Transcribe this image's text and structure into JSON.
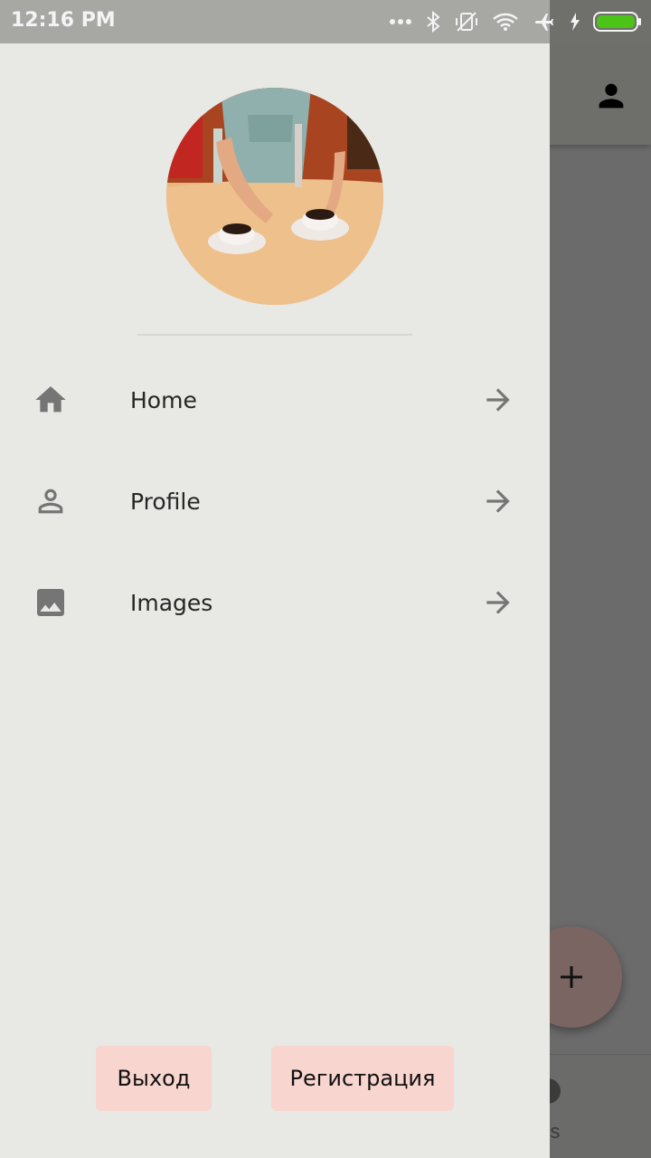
{
  "status_bar": {
    "time": "12:16 PM"
  },
  "drawer": {
    "menu": [
      {
        "label": "Home",
        "icon": "home-icon"
      },
      {
        "label": "Profile",
        "icon": "person-outline-icon"
      },
      {
        "label": "Images",
        "icon": "image-icon"
      }
    ],
    "buttons": {
      "exit": "Выход",
      "register": "Регистрация"
    }
  },
  "background": {
    "bottom_nav_label": "ms",
    "fab_icon": "plus-icon"
  },
  "colors": {
    "drawer_bg": "#e8e8e4",
    "button_bg": "#f8d5cf",
    "battery": "#4cc317"
  }
}
